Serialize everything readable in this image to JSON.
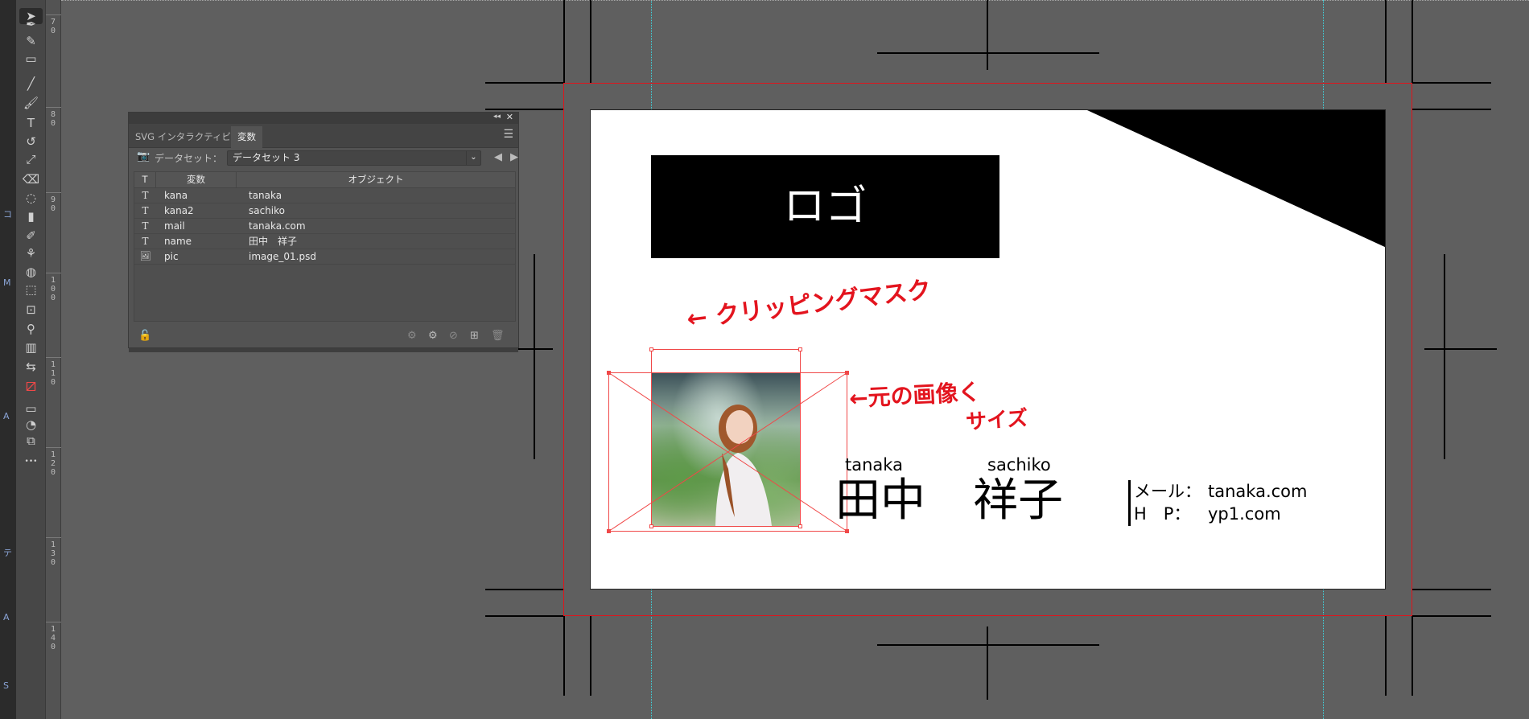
{
  "left_strip": {
    "chars": [
      "コ",
      "M",
      "A",
      "テ",
      "A",
      "S"
    ]
  },
  "toolbar": {
    "tools": [
      {
        "name": "select-arrow-icon",
        "glyph": "➤"
      },
      {
        "name": "pen-icon",
        "glyph": "✒"
      },
      {
        "name": "curvature-icon",
        "glyph": "✎"
      },
      {
        "name": "rectangle-icon",
        "glyph": "▭"
      },
      {
        "name": "line-icon",
        "glyph": "╱"
      },
      {
        "name": "brush-icon",
        "glyph": "🖌"
      },
      {
        "name": "type-icon",
        "glyph": "T"
      },
      {
        "name": "rotate-icon",
        "glyph": "↺"
      },
      {
        "name": "scale-icon",
        "glyph": "⤢"
      },
      {
        "name": "eraser-icon",
        "glyph": "⌫"
      },
      {
        "name": "lasso-icon",
        "glyph": "◌"
      },
      {
        "name": "gradient-icon",
        "glyph": "▮"
      },
      {
        "name": "eyedropper-icon",
        "glyph": "✐"
      },
      {
        "name": "puppet-warp-icon",
        "glyph": "⚘"
      },
      {
        "name": "shape-builder-icon",
        "glyph": "◍"
      },
      {
        "name": "free-transform-icon",
        "glyph": "⬚"
      },
      {
        "name": "artboard-icon",
        "glyph": "⊡"
      },
      {
        "name": "zoom-icon",
        "glyph": "⚲"
      },
      {
        "name": "graph-icon",
        "glyph": "▥"
      },
      {
        "name": "swap-colors-icon",
        "glyph": "⇆"
      },
      {
        "name": "fill-stroke-icon",
        "glyph": "⧄"
      },
      {
        "name": "color-mode-icon",
        "glyph": "▭"
      },
      {
        "name": "draw-mode-icon",
        "glyph": "◔"
      },
      {
        "name": "screen-mode-icon",
        "glyph": "⧉"
      },
      {
        "name": "more-tools-icon",
        "glyph": "•••"
      }
    ]
  },
  "ruler": {
    "labels": [
      "70",
      "80",
      "90",
      "100",
      "110",
      "120",
      "130",
      "140"
    ]
  },
  "panel": {
    "tabs": [
      "SVG インタラクティビティ",
      "変数"
    ],
    "active_tab": 1,
    "dataset_label": "データセット：",
    "dataset_value": "データセット 3",
    "columns": [
      "T",
      "変数",
      "オブジェクト"
    ],
    "rows": [
      {
        "type": "T",
        "variable": "kana",
        "object": "tanaka"
      },
      {
        "type": "T",
        "variable": "kana2",
        "object": "sachiko"
      },
      {
        "type": "T",
        "variable": "mail",
        "object": "tanaka.com"
      },
      {
        "type": "T",
        "variable": "name",
        "object": "田中　祥子"
      },
      {
        "type": "image",
        "variable": "pic",
        "object": "image_01.psd"
      }
    ]
  },
  "card": {
    "logo": "ロゴ",
    "kana_last": "tanaka",
    "kana_first": "sachiko",
    "name_last": "田中",
    "name_first": "祥子",
    "mail_label": "メール：",
    "mail_value": "tanaka.com",
    "hp_label": "H　P：",
    "hp_value": "yp1.com"
  },
  "annotations": {
    "clip": "← クリッピングマスク",
    "orig_line1": "←元の画像く",
    "orig_line2": "サイズ",
    "color": "#e3141e"
  }
}
